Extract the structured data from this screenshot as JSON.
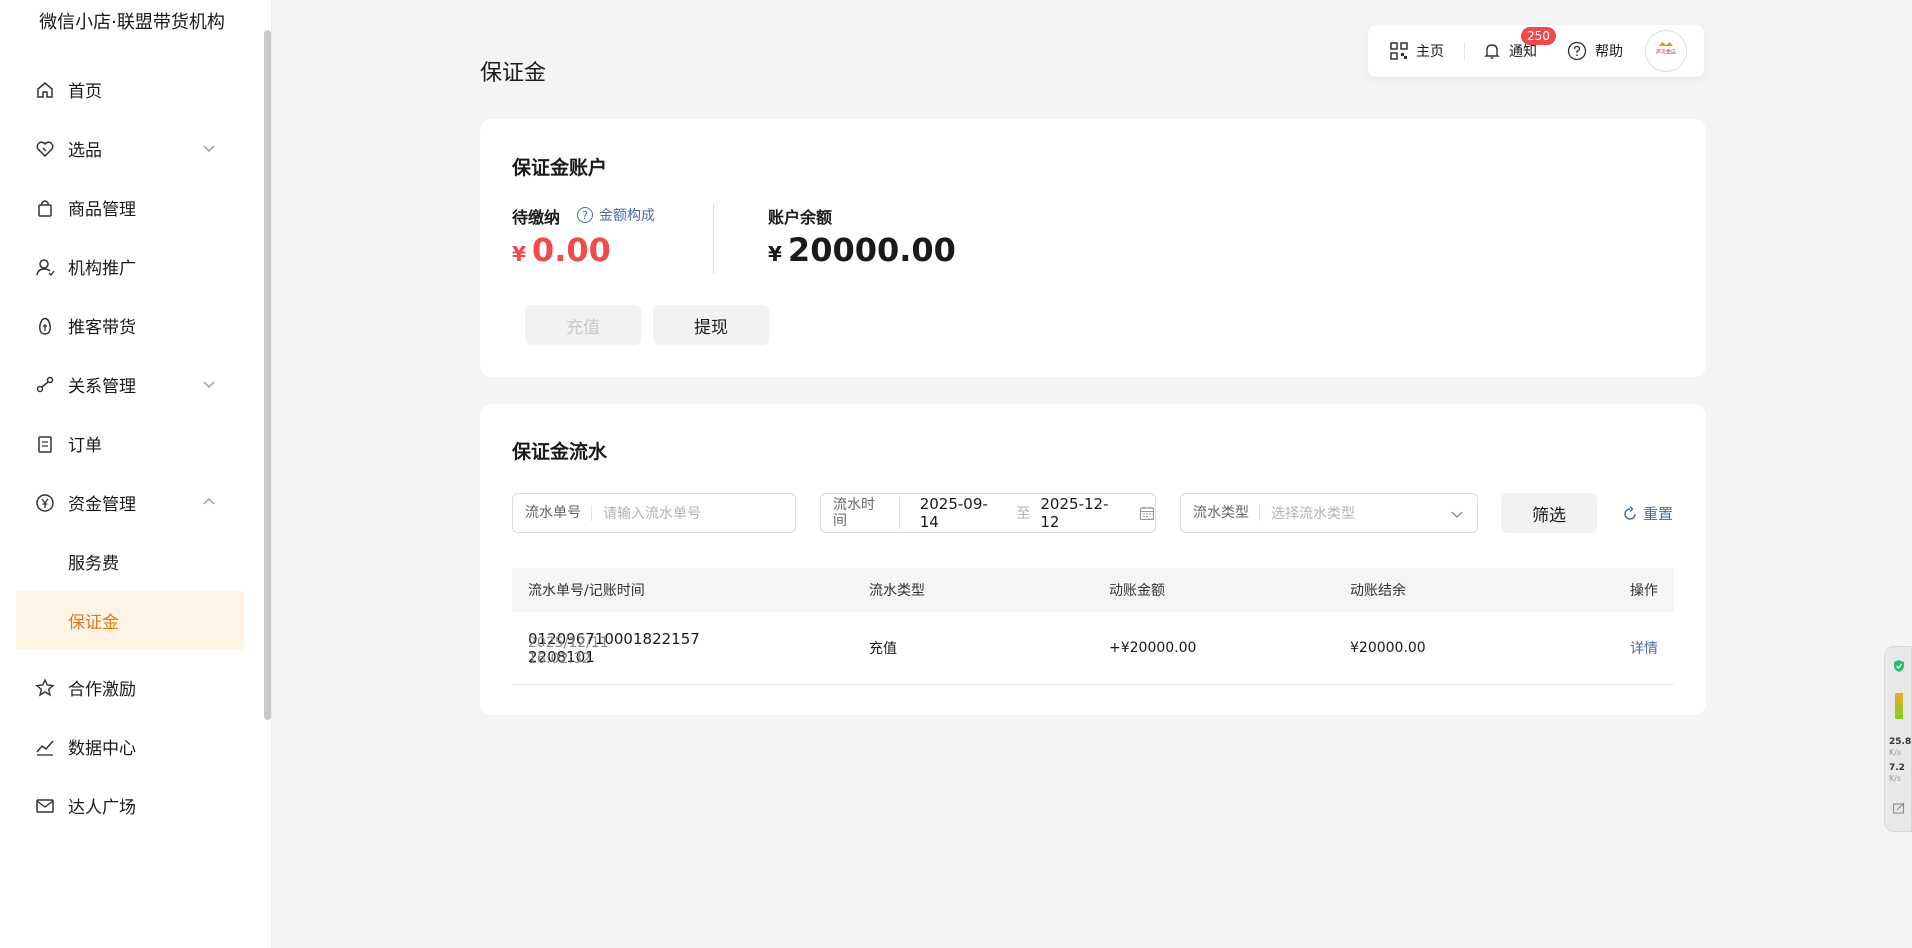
{
  "sidebar": {
    "brand": "微信小店·联盟带货机构",
    "items": [
      {
        "label": "首页"
      },
      {
        "label": "选品"
      },
      {
        "label": "商品管理"
      },
      {
        "label": "机构推广"
      },
      {
        "label": "推客带货"
      },
      {
        "label": "关系管理"
      },
      {
        "label": "订单"
      },
      {
        "label": "资金管理"
      },
      {
        "label": "服务费"
      },
      {
        "label": "保证金"
      },
      {
        "label": "合作激励"
      },
      {
        "label": "数据中心"
      },
      {
        "label": "达人广场"
      }
    ]
  },
  "topbar": {
    "home": "主页",
    "notify": "通知",
    "notify_count": "250",
    "help": "帮助",
    "avatar_text": "声贝金店"
  },
  "page": {
    "title": "保证金"
  },
  "account": {
    "title": "保证金账户",
    "pending_label": "待缴纳",
    "composition_link": "金额构成",
    "pending_currency": "¥",
    "pending_amount": "0.00",
    "balance_label": "账户余额",
    "balance_currency": "¥",
    "balance_amount": "20000.00",
    "recharge_btn": "充值",
    "withdraw_btn": "提现"
  },
  "flow": {
    "title": "保证金流水",
    "filters": {
      "no_label": "流水单号",
      "no_placeholder": "请输入流水单号",
      "time_label": "流水时间",
      "start_date": "2025-09-14",
      "to": "至",
      "end_date": "2025-12-12",
      "type_label": "流水类型",
      "type_placeholder": "选择流水类型",
      "filter_btn": "筛选",
      "reset": "重置"
    },
    "columns": [
      "流水单号/记账时间",
      "流水类型",
      "动账金额",
      "动账结余",
      "操作"
    ],
    "rows": [
      {
        "no": "012096710001822157 2208101",
        "no_display": "012096710001822157 2208101",
        "time": "2025/12/11 16:02:32",
        "type": "充值",
        "amount": "+¥20000.00",
        "balance": "¥20000.00",
        "action": "详情"
      }
    ]
  },
  "widget": {
    "v1": "25.8",
    "u1": "K/s",
    "v2": "7.2",
    "u2": "K/s"
  },
  "colors": {
    "accent": "#e07a18",
    "danger": "#f04a4a",
    "link": "#4b6aa8"
  }
}
